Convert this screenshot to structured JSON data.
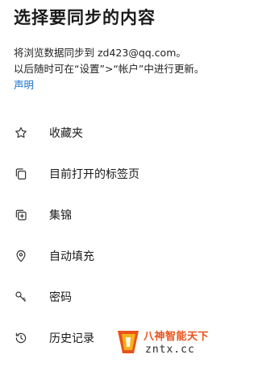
{
  "header": {
    "title": "选择要同步的内容"
  },
  "description": {
    "line1": "将浏览数据同步到 zd423@qq.com。",
    "line2": "以后随时可在“设置”>“帐户”中进行更新。",
    "link": "声明"
  },
  "items": [
    {
      "label": "收藏夹",
      "icon": "star-icon"
    },
    {
      "label": "目前打开的标签页",
      "icon": "tabs-icon"
    },
    {
      "label": "集锦",
      "icon": "collections-icon"
    },
    {
      "label": "自动填充",
      "icon": "location-pin-icon"
    },
    {
      "label": "密码",
      "icon": "key-icon"
    },
    {
      "label": "历史记录",
      "icon": "history-icon"
    }
  ],
  "watermark": {
    "title": "八神智能天下",
    "subtitle": "zntx.cc"
  },
  "colors": {
    "link": "#1a73c9",
    "text": "#1a1a1a",
    "watermark_accent": "#e8531c"
  }
}
